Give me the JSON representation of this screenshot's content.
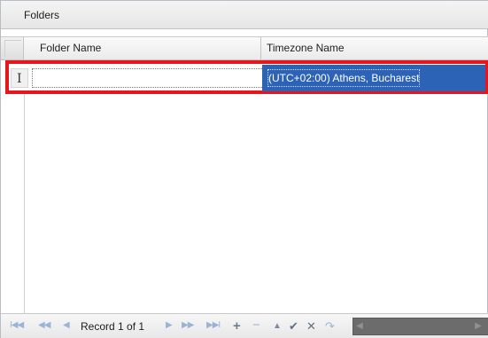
{
  "panel": {
    "title": "Folders"
  },
  "grid": {
    "columns": [
      {
        "label": "Folder Name"
      },
      {
        "label": "Timezone Name"
      }
    ],
    "rows": [
      {
        "folder_name": "",
        "timezone_name": "(UTC+02:00) Athens, Bucharest"
      }
    ],
    "row_indicator": "I"
  },
  "navigator": {
    "first_glyph": "I◀◀",
    "prev_page_glyph": "◀◀",
    "prev_glyph": "◀",
    "record_text": "Record 1 of 1",
    "next_glyph": "▶",
    "next_page_glyph": "▶▶",
    "last_glyph": "▶▶I",
    "append_glyph": "+",
    "remove_glyph": "−",
    "edit_glyph": "▲",
    "end_edit_glyph": "✔",
    "cancel_glyph": "✕",
    "refresh_glyph": "↷",
    "scroll_left_glyph": "◀",
    "scroll_right_glyph": "▶"
  },
  "colors": {
    "selection": "#2c63b7",
    "highlight_border": "#e8161c"
  }
}
